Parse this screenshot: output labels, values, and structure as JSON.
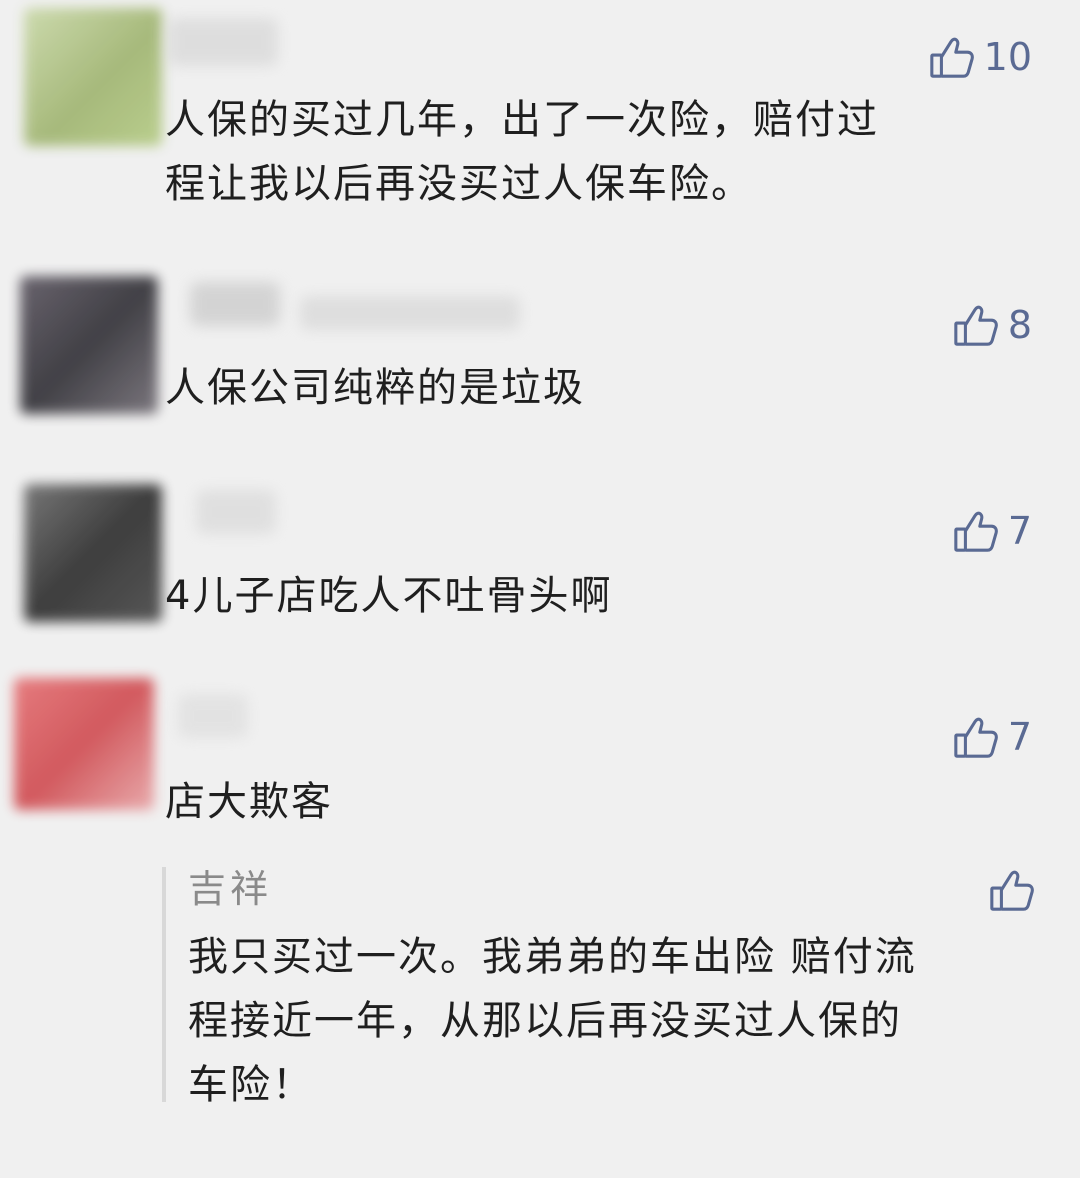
{
  "comments": [
    {
      "likes": "10",
      "lines": [
        "人保的买过几年，出了一次险，赔付过",
        "程让我以后再没买过人保车险。"
      ]
    },
    {
      "likes": "8",
      "lines": [
        "人保公司纯粹的是垃圾"
      ]
    },
    {
      "likes": "7",
      "lines": [
        "4儿子店吃人不吐骨头啊"
      ]
    },
    {
      "likes": "7",
      "lines": [
        "店大欺客"
      ],
      "reply": {
        "author": "吉祥",
        "lines": [
          "我只买过一次。我弟弟的车出险 赔付流",
          "程接近一年，从那以后再没买过人保的",
          "车险！"
        ]
      }
    }
  ],
  "icons": {
    "like": "thumbs-up-icon"
  },
  "colors": {
    "background": "#f0f0f0",
    "accent": "#5a6a93",
    "text": "#1f1f1f",
    "muted": "#8a8a8a"
  }
}
